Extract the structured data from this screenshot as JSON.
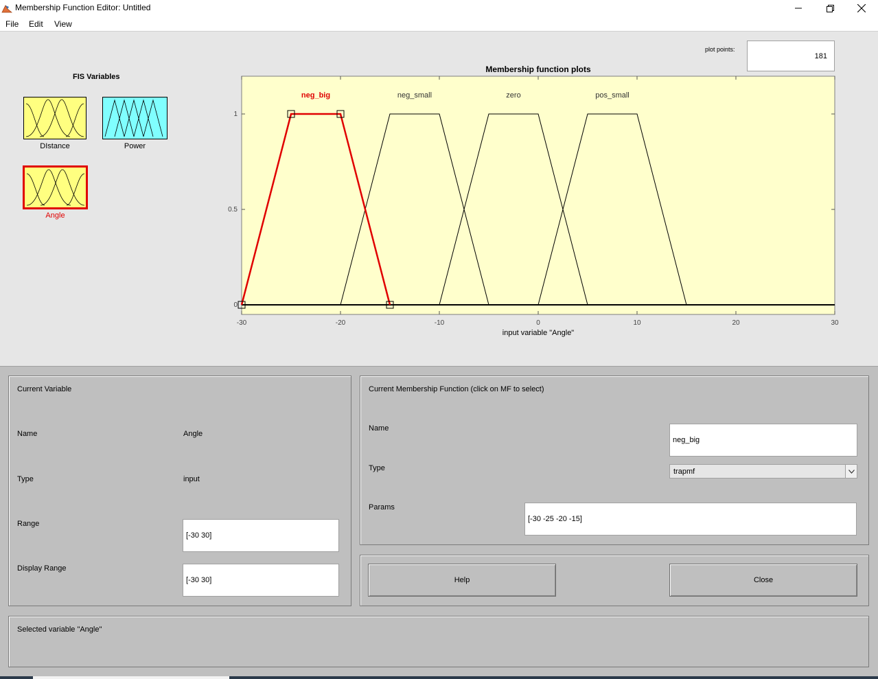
{
  "window": {
    "title": "Membership Function Editor: Untitled",
    "icon": "matlab-icon"
  },
  "menu": [
    "File",
    "Edit",
    "View"
  ],
  "fis": {
    "title": "FIS Variables",
    "variables": [
      {
        "name": "DIstance",
        "kind": "input",
        "color": "#ffff80",
        "selected": false
      },
      {
        "name": "Power",
        "kind": "output",
        "color": "#80ffff",
        "selected": false
      },
      {
        "name": "Angle",
        "kind": "input",
        "color": "#ffff80",
        "selected": true
      }
    ]
  },
  "plot_points": {
    "label": "plot points:",
    "value": "181"
  },
  "chart_data": {
    "type": "line",
    "title": "Membership function plots",
    "xlabel": "input variable \"Angle\"",
    "xlim": [
      -30,
      30
    ],
    "ylim": [
      0,
      1
    ],
    "x_ticks": [
      "-30",
      "-20",
      "-10",
      "0",
      "10",
      "20",
      "30"
    ],
    "y_ticks": [
      "0",
      "0.5",
      "1"
    ],
    "background": "#ffffcc",
    "selected_color": "#e00000",
    "series": [
      {
        "name": "neg_big",
        "params": [
          -30,
          -25,
          -20,
          -15
        ],
        "selected": true
      },
      {
        "name": "neg_small",
        "params": [
          -20,
          -15,
          -10,
          -5
        ],
        "selected": false
      },
      {
        "name": "zero",
        "params": [
          -10,
          -5,
          0,
          5
        ],
        "selected": false
      },
      {
        "name": "pos_small",
        "params": [
          0,
          5,
          10,
          15
        ],
        "selected": false
      }
    ]
  },
  "current_variable": {
    "title": "Current Variable",
    "name_label": "Name",
    "name_value": "Angle",
    "type_label": "Type",
    "type_value": "input",
    "range_label": "Range",
    "range_value": "[-30 30]",
    "display_range_label": "Display Range",
    "display_range_value": "[-30 30]"
  },
  "current_mf": {
    "title": "Current Membership Function (click on MF to select)",
    "name_label": "Name",
    "name_value": "neg_big",
    "type_label": "Type",
    "type_value": "trapmf",
    "params_label": "Params",
    "params_value": "[-30 -25 -20 -15]"
  },
  "buttons": {
    "help": "Help",
    "close": "Close"
  },
  "status": "Selected variable \"Angle\""
}
